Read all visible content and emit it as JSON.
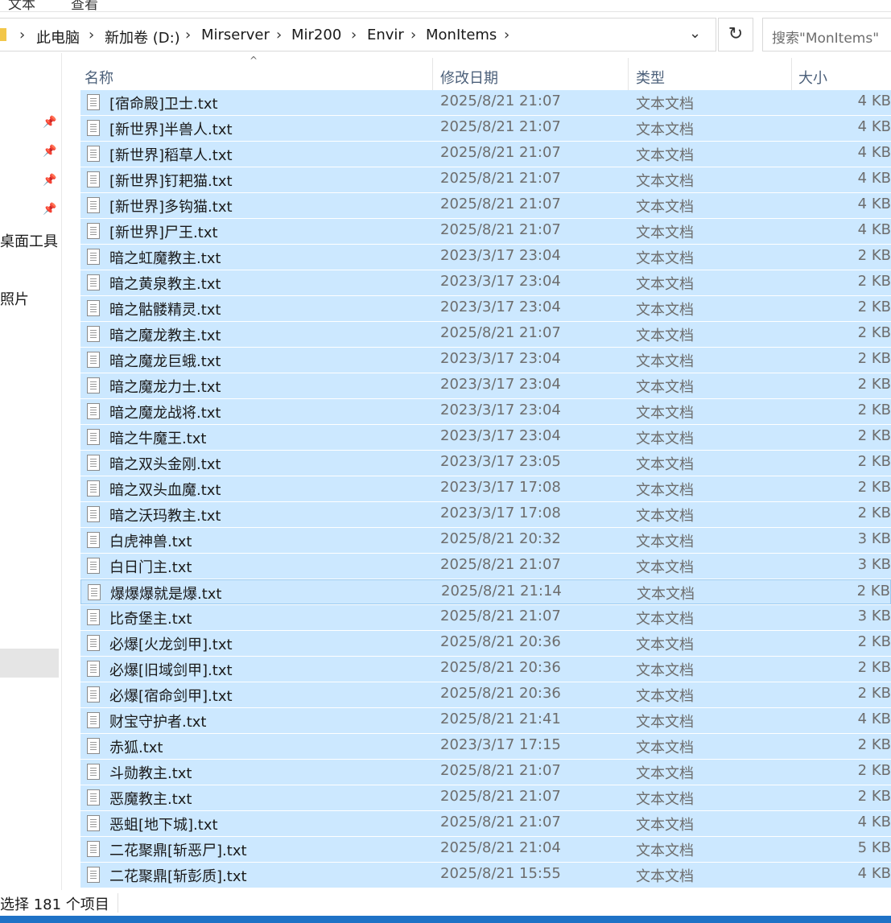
{
  "ribbon": {
    "items": [
      "文本",
      "查看"
    ]
  },
  "address": {
    "crumbs": [
      "此电脑",
      "新加卷 (D:)",
      "Mirserver",
      "Mir200",
      "Envir",
      "MonItems"
    ],
    "dropdown_glyph": "⌄",
    "refresh_glyph": "↻"
  },
  "search": {
    "placeholder": "搜索\"MonItems\""
  },
  "nav": {
    "labels": [
      "桌面工具",
      "照片"
    ]
  },
  "columns": {
    "name": "名称",
    "date": "修改日期",
    "type": "类型",
    "size": "大小"
  },
  "files": [
    {
      "name": "[宿命殿]卫士.txt",
      "date": "2025/8/21 21:07",
      "type": "文本文档",
      "size": "4 KB"
    },
    {
      "name": "[新世界]半兽人.txt",
      "date": "2025/8/21 21:07",
      "type": "文本文档",
      "size": "4 KB"
    },
    {
      "name": "[新世界]稻草人.txt",
      "date": "2025/8/21 21:07",
      "type": "文本文档",
      "size": "4 KB"
    },
    {
      "name": "[新世界]钉耙猫.txt",
      "date": "2025/8/21 21:07",
      "type": "文本文档",
      "size": "4 KB"
    },
    {
      "name": "[新世界]多钩猫.txt",
      "date": "2025/8/21 21:07",
      "type": "文本文档",
      "size": "4 KB"
    },
    {
      "name": "[新世界]尸王.txt",
      "date": "2025/8/21 21:07",
      "type": "文本文档",
      "size": "4 KB"
    },
    {
      "name": "暗之虹魔教主.txt",
      "date": "2023/3/17 23:04",
      "type": "文本文档",
      "size": "2 KB"
    },
    {
      "name": "暗之黄泉教主.txt",
      "date": "2023/3/17 23:04",
      "type": "文本文档",
      "size": "2 KB"
    },
    {
      "name": "暗之骷髅精灵.txt",
      "date": "2023/3/17 23:04",
      "type": "文本文档",
      "size": "2 KB"
    },
    {
      "name": "暗之魔龙教主.txt",
      "date": "2025/8/21 21:07",
      "type": "文本文档",
      "size": "2 KB"
    },
    {
      "name": "暗之魔龙巨蛾.txt",
      "date": "2023/3/17 23:04",
      "type": "文本文档",
      "size": "2 KB"
    },
    {
      "name": "暗之魔龙力士.txt",
      "date": "2023/3/17 23:04",
      "type": "文本文档",
      "size": "2 KB"
    },
    {
      "name": "暗之魔龙战将.txt",
      "date": "2023/3/17 23:04",
      "type": "文本文档",
      "size": "2 KB"
    },
    {
      "name": "暗之牛魔王.txt",
      "date": "2023/3/17 23:04",
      "type": "文本文档",
      "size": "2 KB"
    },
    {
      "name": "暗之双头金刚.txt",
      "date": "2023/3/17 23:05",
      "type": "文本文档",
      "size": "2 KB"
    },
    {
      "name": "暗之双头血魔.txt",
      "date": "2023/3/17 17:08",
      "type": "文本文档",
      "size": "2 KB"
    },
    {
      "name": "暗之沃玛教主.txt",
      "date": "2023/3/17 17:08",
      "type": "文本文档",
      "size": "2 KB"
    },
    {
      "name": "白虎神兽.txt",
      "date": "2025/8/21 20:32",
      "type": "文本文档",
      "size": "3 KB"
    },
    {
      "name": "白日门主.txt",
      "date": "2025/8/21 21:07",
      "type": "文本文档",
      "size": "3 KB"
    },
    {
      "name": "爆爆爆就是爆.txt",
      "date": "2025/8/21 21:14",
      "type": "文本文档",
      "size": "2 KB"
    },
    {
      "name": "比奇堡主.txt",
      "date": "2025/8/21 21:07",
      "type": "文本文档",
      "size": "3 KB"
    },
    {
      "name": "必爆[火龙剑甲].txt",
      "date": "2025/8/21 20:36",
      "type": "文本文档",
      "size": "2 KB"
    },
    {
      "name": "必爆[旧域剑甲].txt",
      "date": "2025/8/21 20:36",
      "type": "文本文档",
      "size": "2 KB"
    },
    {
      "name": "必爆[宿命剑甲].txt",
      "date": "2025/8/21 20:36",
      "type": "文本文档",
      "size": "2 KB"
    },
    {
      "name": "财宝守护者.txt",
      "date": "2025/8/21 21:41",
      "type": "文本文档",
      "size": "4 KB"
    },
    {
      "name": "赤狐.txt",
      "date": "2023/3/17 17:15",
      "type": "文本文档",
      "size": "2 KB"
    },
    {
      "name": "斗勋教主.txt",
      "date": "2025/8/21 21:07",
      "type": "文本文档",
      "size": "2 KB"
    },
    {
      "name": "恶魔教主.txt",
      "date": "2025/8/21 21:07",
      "type": "文本文档",
      "size": "2 KB"
    },
    {
      "name": "恶蛆[地下城].txt",
      "date": "2025/8/21 21:07",
      "type": "文本文档",
      "size": "4 KB"
    },
    {
      "name": "二花聚鼎[斩恶尸].txt",
      "date": "2025/8/21 21:04",
      "type": "文本文档",
      "size": "5 KB"
    },
    {
      "name": "二花聚鼎[斩彭质].txt",
      "date": "2025/8/21 15:55",
      "type": "文本文档",
      "size": "4 KB"
    }
  ],
  "status": {
    "text": "选择 181 个项目"
  },
  "colors": {
    "selection": "#cce8ff",
    "focus_border": "#99c9ef",
    "header_text": "#4c607a",
    "taskbar": "#1f72c6"
  }
}
